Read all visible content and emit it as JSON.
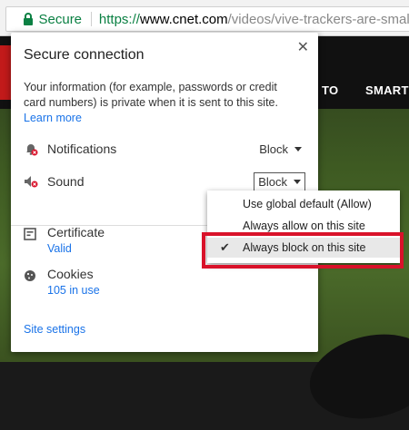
{
  "omnibox": {
    "secure_label": "Secure",
    "url_scheme": "https://",
    "url_host": "www.cnet.com",
    "url_path": "/videos/vive-trackers-are-small-"
  },
  "page": {
    "nav_items": [
      "TO",
      "SMART"
    ]
  },
  "popup": {
    "title": "Secure connection",
    "description": "Your information (for example, passwords or credit card numbers) is private when it is sent to this site.",
    "learn_more": "Learn more",
    "permissions": [
      {
        "label": "Notifications",
        "value": "Block",
        "icon": "bell-blocked-icon"
      },
      {
        "label": "Sound",
        "value": "Block",
        "icon": "speaker-muted-icon"
      }
    ],
    "certificate": {
      "label": "Certificate",
      "status": "Valid",
      "icon": "certificate-icon"
    },
    "cookies": {
      "label": "Cookies",
      "status": "105 in use",
      "icon": "cookie-icon"
    },
    "site_settings": "Site settings"
  },
  "sound_menu": {
    "options": [
      "Use global default (Allow)",
      "Always allow on this site",
      "Always block on this site"
    ],
    "selected": "Always block on this site"
  },
  "colors": {
    "secure_green": "#0b8043",
    "link_blue": "#1a73e8",
    "highlight_red": "#d9122a"
  }
}
